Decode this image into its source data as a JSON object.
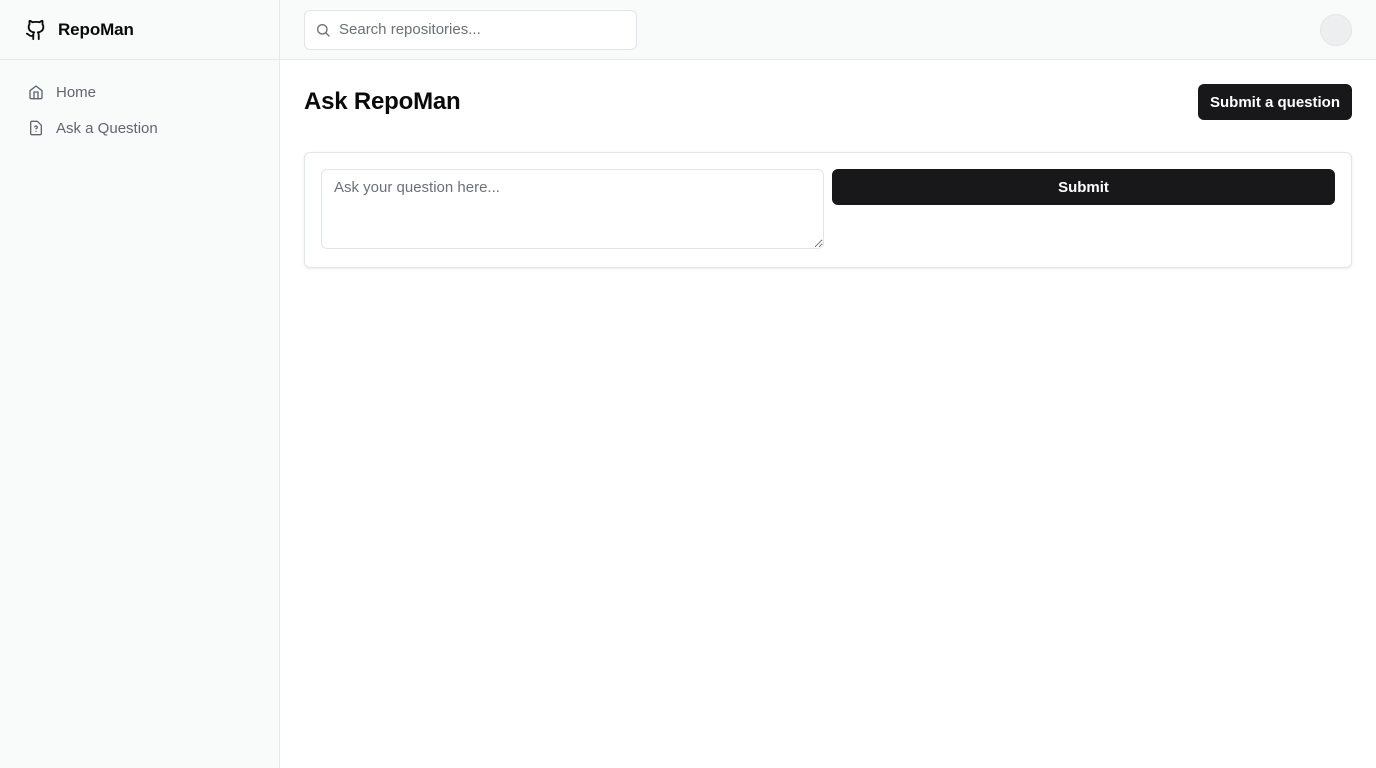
{
  "brand": {
    "name": "RepoMan",
    "icon": "github-icon"
  },
  "sidebar": {
    "items": [
      {
        "label": "Home",
        "icon": "home-icon"
      },
      {
        "label": "Ask a Question",
        "icon": "file-question-icon"
      }
    ]
  },
  "topbar": {
    "search": {
      "placeholder": "Search repositories...",
      "value": "",
      "icon": "search-icon"
    }
  },
  "page": {
    "title": "Ask RepoMan",
    "header_button": "Submit a question"
  },
  "question_form": {
    "placeholder": "Ask your question here...",
    "value": "",
    "submit_label": "Submit"
  },
  "colors": {
    "primary_button": "#18181b",
    "sidebar_bg": "#f9fafa",
    "muted_text": "#5f6670"
  }
}
